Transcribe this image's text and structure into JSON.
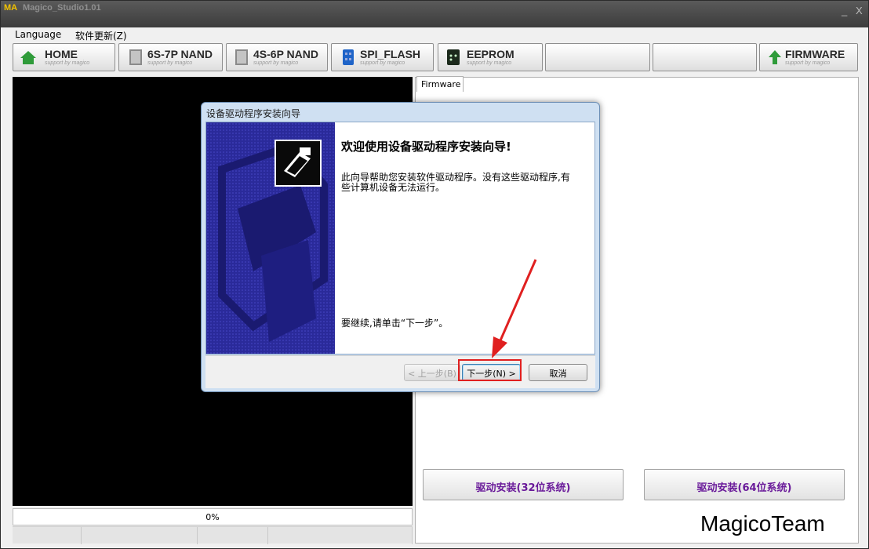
{
  "app": {
    "logo": "MA",
    "title": "Magico_Studio1.01",
    "minimize": "_",
    "close": "X"
  },
  "menu": {
    "items": [
      "Language",
      "软件更新(Z)"
    ]
  },
  "toolbar": {
    "buttons": [
      {
        "label": "HOME",
        "sub": "support by magico",
        "icon": "home-icon"
      },
      {
        "label": "6S-7P NAND",
        "sub": "support by magico",
        "icon": "chip-icon"
      },
      {
        "label": "4S-6P NAND",
        "sub": "support by magico",
        "icon": "chip-icon"
      },
      {
        "label": "SPI_FLASH",
        "sub": "support by magico",
        "icon": "spi-chip-icon"
      },
      {
        "label": "EEPROM",
        "sub": "support by magico",
        "icon": "eeprom-icon"
      },
      {
        "label": "",
        "sub": "",
        "icon": ""
      },
      {
        "label": "",
        "sub": "",
        "icon": ""
      },
      {
        "label": "FIRMWARE",
        "sub": "support by magico",
        "icon": "up-arrow-icon"
      }
    ]
  },
  "progress": {
    "value": 0,
    "text": "0%"
  },
  "right_panel": {
    "tab": "Firmware",
    "btn_32": "驱动安装(32位系统)",
    "btn_64": "驱动安装(64位系统)",
    "watermark": "MagicoTeam"
  },
  "dialog": {
    "title": "设备驱动程序安装向导",
    "heading": "欢迎使用设备驱动程序安装向导!",
    "text": "此向导帮助您安装软件驱动程序。没有这些驱动程序,有些计算机设备无法运行。",
    "footer_text": "要继续,请单击“下一步”。",
    "back": "< 上一步(B)",
    "next": "下一步(N) >",
    "cancel": "取消"
  },
  "colors": {
    "accent_purple": "#6a1b9a",
    "highlight_red": "#e02020",
    "wizard_blue": "#2a2a9a"
  }
}
